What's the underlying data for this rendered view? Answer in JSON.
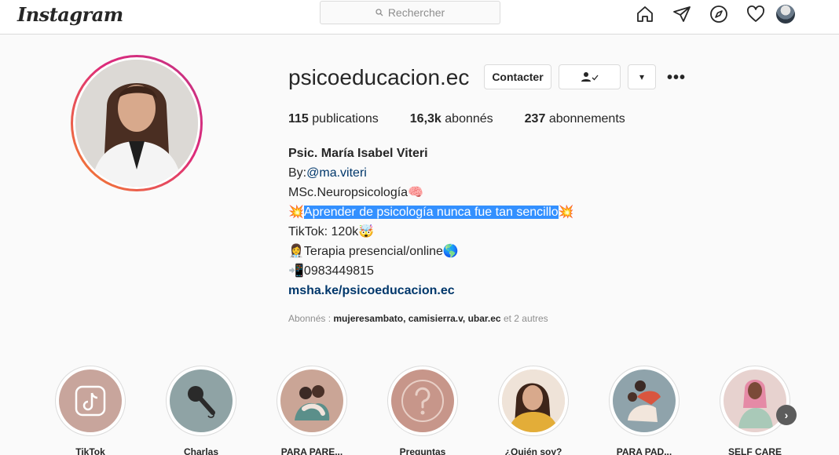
{
  "nav": {
    "logo": "Instagram",
    "search_placeholder": "Rechercher"
  },
  "profile": {
    "username": "psicoeducacion.ec",
    "buttons": {
      "contact": "Contacter",
      "dropdown": "▾",
      "more": "•••"
    },
    "stats": [
      {
        "value": "115",
        "label": "publications"
      },
      {
        "value": "16,3k",
        "label": "abonnés"
      },
      {
        "value": "237",
        "label": "abonnements"
      }
    ],
    "bio": {
      "name": "Psic. María Isabel Viteri",
      "by_prefix": " By:",
      "by_handle": "@ma.viteri",
      "line_msc": "MSc.Neuropsicología",
      "line_msc_emoji": "🧠",
      "line_tagline_pre_emoji": "💥",
      "line_tagline": "Aprender de psicología nunca fue tan sencillo",
      "line_tagline_post_emoji": "💥",
      "line_tiktok": "TikTok: 120k",
      "line_tiktok_emoji": "🤯",
      "line_therapy_emoji": "👩‍⚕️",
      "line_therapy": "Terapia presencial/online",
      "line_therapy_post_emoji": "🌎",
      "line_phone_emoji": "📲",
      "line_phone": "0983449815",
      "link": "msha.ke/psicoeducacion.ec"
    },
    "followed_by": {
      "prefix": "Abonnés : ",
      "names": "mujeresambato, camisierra.v, ubar.ec",
      "suffix": " et 2 autres"
    }
  },
  "highlights": [
    {
      "label": "TikTok",
      "bg": "#c8a59c"
    },
    {
      "label": "Charlas",
      "bg": "#8fa3a5"
    },
    {
      "label": "PARA PARE...",
      "bg": "#caa596"
    },
    {
      "label": "Preguntas",
      "bg": "#c7968a"
    },
    {
      "label": "¿Quién soy?",
      "bg": "#d9a441"
    },
    {
      "label": "PARA PAD...",
      "bg": "#8fa3ab"
    },
    {
      "label": "SELF CARE",
      "bg": "#e7d2cf"
    }
  ],
  "colors": {
    "accent": "#0095f6",
    "ring_start": "#f58529",
    "ring_end": "#c13584",
    "link": "#00376b",
    "selection": "#3390ff"
  }
}
